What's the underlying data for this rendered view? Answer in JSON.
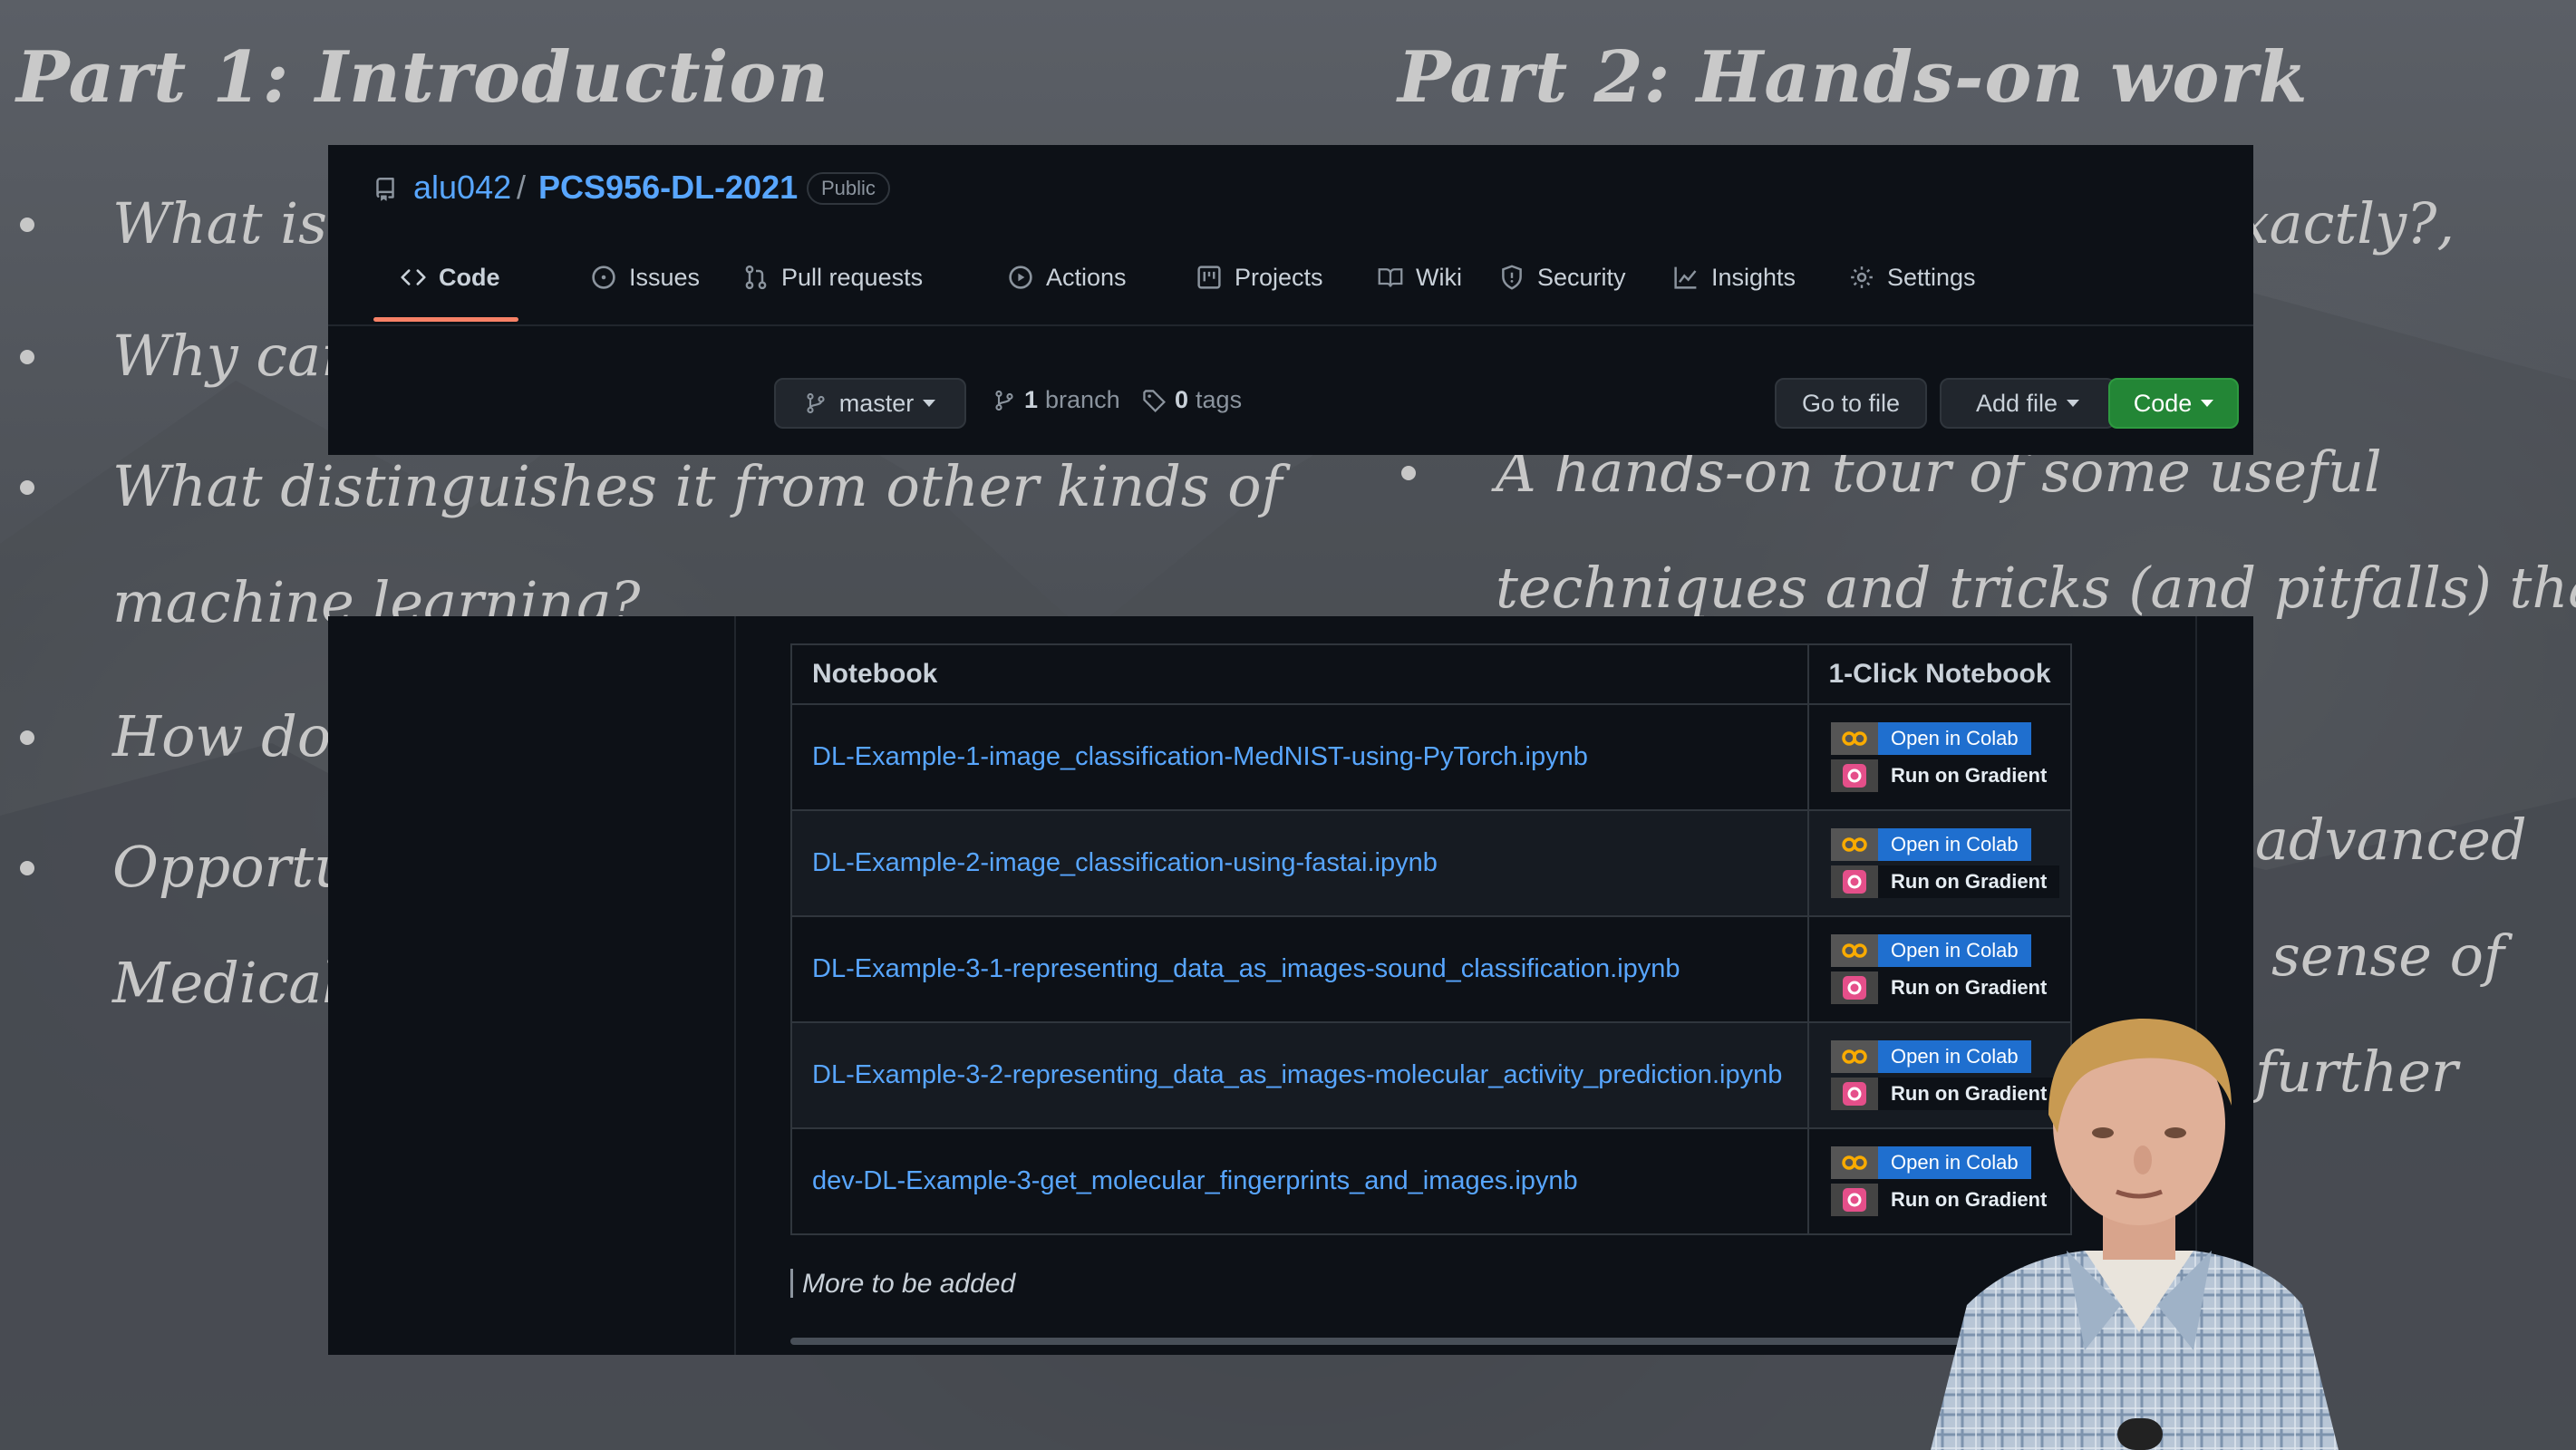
{
  "slide": {
    "left_title": "Part 1: Introduction",
    "right_title": "Part 2: Hands-on work",
    "left_bullets": [
      "What is",
      "Why car",
      "What distinguishes it from other kinds of",
      "machine learning?",
      "How do",
      "Opportu",
      "Medical"
    ],
    "right_fragments": [
      "exactly?,",
      "A hands-on tour of some useful",
      "techniques and tricks (and pitfalls) that",
      "advanced",
      "sense of",
      "further"
    ]
  },
  "repo": {
    "owner": "alu042",
    "separator": "/",
    "name": "PCS956-DL-2021",
    "visibility": "Public"
  },
  "tabs": [
    {
      "label": "Code",
      "icon": "code-icon",
      "active": true
    },
    {
      "label": "Issues",
      "icon": "issue-icon"
    },
    {
      "label": "Pull requests",
      "icon": "pull-request-icon"
    },
    {
      "label": "Actions",
      "icon": "play-icon"
    },
    {
      "label": "Projects",
      "icon": "project-icon"
    },
    {
      "label": "Wiki",
      "icon": "book-icon"
    },
    {
      "label": "Security",
      "icon": "shield-icon"
    },
    {
      "label": "Insights",
      "icon": "graph-icon"
    },
    {
      "label": "Settings",
      "icon": "gear-icon"
    }
  ],
  "toolbar": {
    "branch": "master",
    "branch_count": "1",
    "branch_label": "branch",
    "tag_count": "0",
    "tag_label": "tags",
    "go_to_file": "Go to file",
    "add_file": "Add file",
    "code": "Code"
  },
  "table": {
    "headers": [
      "Notebook",
      "1-Click Notebook"
    ],
    "rows": [
      {
        "name": "DL-Example-1-image_classification-MedNIST-using-PyTorch.ipynb"
      },
      {
        "name": "DL-Example-2-image_classification-using-fastai.ipynb"
      },
      {
        "name": "DL-Example-3-1-representing_data_as_images-sound_classification.ipynb"
      },
      {
        "name": "DL-Example-3-2-representing_data_as_images-molecular_activity_prediction.ipynb"
      },
      {
        "name": "dev-DL-Example-3-get_molecular_fingerprints_and_images.ipynb"
      }
    ],
    "colab_label": "Open in Colab",
    "gradient_label": "Run on Gradient"
  },
  "more_text": "More to be added",
  "colors": {
    "accent_link": "#58a6ff",
    "green_button": "#238636",
    "tab_underline": "#f78166",
    "colab_blue": "#1f6fcf",
    "colab_orange": "#f9ab00"
  }
}
